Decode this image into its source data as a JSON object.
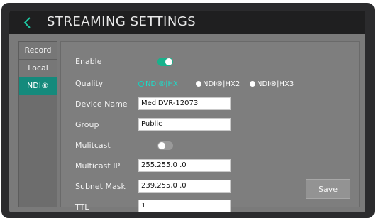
{
  "header": {
    "title": "STREAMING SETTINGS",
    "back_icon": "chevron-left-icon",
    "accent_color": "#1ec9a4"
  },
  "sidebar": {
    "tabs": [
      {
        "label": "Record",
        "active": false
      },
      {
        "label": "Local",
        "active": false
      },
      {
        "label": "NDI®",
        "active": true
      }
    ],
    "active_color": "#158a7c"
  },
  "form": {
    "enable": {
      "label": "Enable",
      "on": true
    },
    "quality": {
      "label": "Quality",
      "options": [
        "NDI®|HX",
        "NDI®|HX2",
        "NDI®|HX3"
      ]
    },
    "device_name": {
      "label": "Device Name",
      "value": "MediDVR-12073"
    },
    "group": {
      "label": "Group",
      "value": "Public"
    },
    "multicast": {
      "label": "Mulitcast",
      "on": false
    },
    "multicast_ip": {
      "label": "Multicast IP",
      "value": "255.255.0 .0"
    },
    "subnet_mask": {
      "label": "Subnet Mask",
      "value": "239.255.0 .0"
    },
    "ttl": {
      "label": "TTL",
      "value": "1"
    },
    "save_label": "Save"
  }
}
